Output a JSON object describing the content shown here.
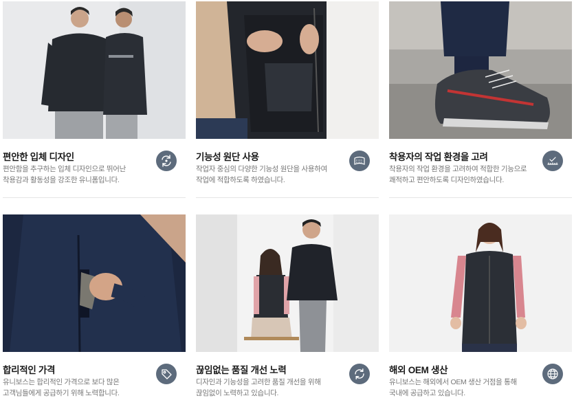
{
  "features": [
    {
      "title": "편안한 입체 디자인",
      "desc": [
        "편안함을 추구하는 입체 디자인으로 뛰어난",
        "착용감과 활동성을 강조한 유니폼입니다."
      ],
      "icon": "rotate-arrows-icon",
      "photo": "two-men-quilted-jackets"
    },
    {
      "title": "기능성 원단 사용",
      "desc": [
        "작업자 중심의 다양한 기능성 원단을 사용하여",
        "작업에 적합하도록 하였습니다."
      ],
      "icon": "fabric-icon",
      "photo": "vest-inner-pocket"
    },
    {
      "title": "착용자의 작업 환경을 고려",
      "desc": [
        "착용자의 작업 환경을 고려하여 적합한 기능으로",
        "쾌적하고 편안하도록 디자인하였습니다."
      ],
      "icon": "measure-check-icon",
      "photo": "safety-shoe"
    },
    {
      "title": "합리적인 가격",
      "desc": [
        "유니보스는 합리적인 가격으로 보다 많은",
        "고객님들에게 공급하기 위해 노력합니다."
      ],
      "icon": "price-tag-icon",
      "photo": "jacket-chest-pocket"
    },
    {
      "title": "끊임없는 품질 개선 노력",
      "desc": [
        "디자인과 기능성을 고려한 품질 개선을 위해",
        "끊임없이 노력하고 있습니다."
      ],
      "icon": "refresh-icon",
      "photo": "man-and-woman-uniforms"
    },
    {
      "title": "해외 OEM 생산",
      "desc": [
        "유니보스는 해외에서 OEM 생산 거점을 통해",
        "국내에 공급하고 있습니다."
      ],
      "icon": "globe-icon",
      "photo": "woman-padded-vest"
    }
  ],
  "colors": {
    "icon_bg": "#5d6b7c",
    "title": "#1a1a1a",
    "desc": "#777777",
    "divider": "#e6e6e6"
  }
}
